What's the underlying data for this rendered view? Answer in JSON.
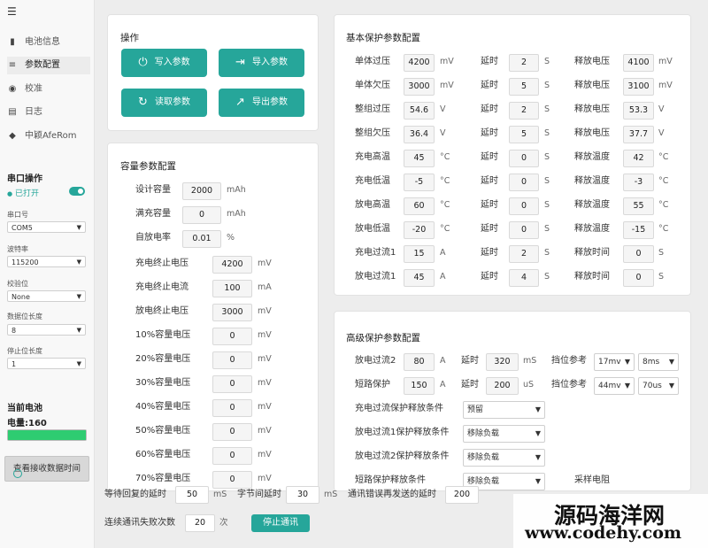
{
  "sidebar": {
    "menu_icon": "hamburger-icon",
    "nav": [
      {
        "label": "电池信息",
        "icon": "battery-icon"
      },
      {
        "label": "参数配置",
        "icon": "sliders-icon",
        "active": true
      },
      {
        "label": "校准",
        "icon": "gauge-icon"
      },
      {
        "label": "日志",
        "icon": "log-icon"
      },
      {
        "label": "中颖AfeRom",
        "icon": "chip-icon"
      }
    ],
    "serial_title": "串口操作",
    "serial_status": "已打开",
    "fields": [
      {
        "label": "串口号",
        "value": "COM5"
      },
      {
        "label": "波特率",
        "value": "115200"
      },
      {
        "label": "校验位",
        "value": "None"
      },
      {
        "label": "数据位长度",
        "value": "8"
      },
      {
        "label": "停止位长度",
        "value": "1"
      }
    ],
    "battery_title": "当前电池",
    "battery_label": "电量:160",
    "battery_level": 1.0,
    "check_button": "查看接收数据时间"
  },
  "operations": {
    "title": "操作",
    "buttons": [
      {
        "label": "写入参数",
        "icon": "power-icon"
      },
      {
        "label": "导入参数",
        "icon": "import-icon"
      },
      {
        "label": "读取参数",
        "icon": "refresh-icon"
      },
      {
        "label": "导出参数",
        "icon": "export-icon"
      }
    ]
  },
  "capacity": {
    "title": "容量参数配置",
    "rows_top": [
      {
        "label": "设计容量",
        "value": "2000",
        "unit": "mAh"
      },
      {
        "label": "满充容量",
        "value": "0",
        "unit": "mAh"
      },
      {
        "label": "自放电率",
        "value": "0.01",
        "unit": "%"
      }
    ],
    "rows": [
      {
        "label": "充电终止电压",
        "value": "4200",
        "unit": "mV"
      },
      {
        "label": "充电终止电流",
        "value": "100",
        "unit": "mA"
      },
      {
        "label": "放电终止电压",
        "value": "3000",
        "unit": "mV"
      },
      {
        "label": "10%容量电压",
        "value": "0",
        "unit": "mV"
      },
      {
        "label": "20%容量电压",
        "value": "0",
        "unit": "mV"
      },
      {
        "label": "30%容量电压",
        "value": "0",
        "unit": "mV"
      },
      {
        "label": "40%容量电压",
        "value": "0",
        "unit": "mV"
      },
      {
        "label": "50%容量电压",
        "value": "0",
        "unit": "mV"
      },
      {
        "label": "60%容量电压",
        "value": "0",
        "unit": "mV"
      },
      {
        "label": "70%容量电压",
        "value": "0",
        "unit": "mV"
      }
    ]
  },
  "basic": {
    "title": "基本保护参数配置",
    "rows": [
      {
        "label": "单体过压",
        "value": "4200",
        "unit": "mV",
        "delay": "2",
        "delay_unit": "S",
        "rel_label": "释放电压",
        "rel_value": "4100",
        "rel_unit": "mV"
      },
      {
        "label": "单体欠压",
        "value": "3000",
        "unit": "mV",
        "delay": "5",
        "delay_unit": "S",
        "rel_label": "释放电压",
        "rel_value": "3100",
        "rel_unit": "mV"
      },
      {
        "label": "整组过压",
        "value": "54.6",
        "unit": "V",
        "delay": "2",
        "delay_unit": "S",
        "rel_label": "释放电压",
        "rel_value": "53.3",
        "rel_unit": "V"
      },
      {
        "label": "整组欠压",
        "value": "36.4",
        "unit": "V",
        "delay": "5",
        "delay_unit": "S",
        "rel_label": "释放电压",
        "rel_value": "37.7",
        "rel_unit": "V"
      },
      {
        "label": "充电高温",
        "value": "45",
        "unit": "°C",
        "delay": "0",
        "delay_unit": "S",
        "rel_label": "释放温度",
        "rel_value": "42",
        "rel_unit": "°C"
      },
      {
        "label": "充电低温",
        "value": "-5",
        "unit": "°C",
        "delay": "0",
        "delay_unit": "S",
        "rel_label": "释放温度",
        "rel_value": "-3",
        "rel_unit": "°C"
      },
      {
        "label": "放电高温",
        "value": "60",
        "unit": "°C",
        "delay": "0",
        "delay_unit": "S",
        "rel_label": "释放温度",
        "rel_value": "55",
        "rel_unit": "°C"
      },
      {
        "label": "放电低温",
        "value": "-20",
        "unit": "°C",
        "delay": "0",
        "delay_unit": "S",
        "rel_label": "释放温度",
        "rel_value": "-15",
        "rel_unit": "°C"
      },
      {
        "label": "充电过流1",
        "value": "15",
        "unit": "A",
        "delay": "2",
        "delay_unit": "S",
        "rel_label": "释放时间",
        "rel_value": "0",
        "rel_unit": "S"
      },
      {
        "label": "放电过流1",
        "value": "45",
        "unit": "A",
        "delay": "4",
        "delay_unit": "S",
        "rel_label": "释放时间",
        "rel_value": "0",
        "rel_unit": "S"
      }
    ],
    "delay_label": "延时"
  },
  "advanced": {
    "title": "高级保护参数配置",
    "rows": [
      {
        "label": "放电过流2",
        "value": "80",
        "unit": "A",
        "delay_label": "延时",
        "delay": "320",
        "delay_unit": "mS",
        "gear_label": "挡位参考",
        "gear1": "17mv",
        "gear2": "8ms"
      },
      {
        "label": "短路保护",
        "value": "150",
        "unit": "A",
        "delay_label": "延时",
        "delay": "200",
        "delay_unit": "uS",
        "gear_label": "挡位参考",
        "gear1": "44mv",
        "gear2": "70us"
      }
    ],
    "conditions": [
      {
        "label": "充电过流保护释放条件",
        "value": "预留"
      },
      {
        "label": "放电过流1保护释放条件",
        "value": "移除负载"
      },
      {
        "label": "放电过流2保护释放条件",
        "value": "移除负载"
      },
      {
        "label": "短路保护释放条件",
        "value": "移除负载"
      }
    ],
    "partial_label": "采样电阻"
  },
  "bottom": {
    "wait_label": "等待回复的延时",
    "wait_value": "50",
    "wait_unit": "mS",
    "byte_label": "字节间延时",
    "byte_value": "30",
    "byte_unit": "mS",
    "resend_label": "通讯错误再发送的延时",
    "resend_value": "200",
    "fail_label": "连续通讯失败次数",
    "fail_value": "20",
    "fail_unit": "次",
    "stop_button": "停止通讯"
  },
  "watermark": {
    "line1": "源码海洋网",
    "line2": "www.codehy.com"
  },
  "colors": {
    "accent": "#26a69a",
    "battery": "#2ecc71"
  }
}
